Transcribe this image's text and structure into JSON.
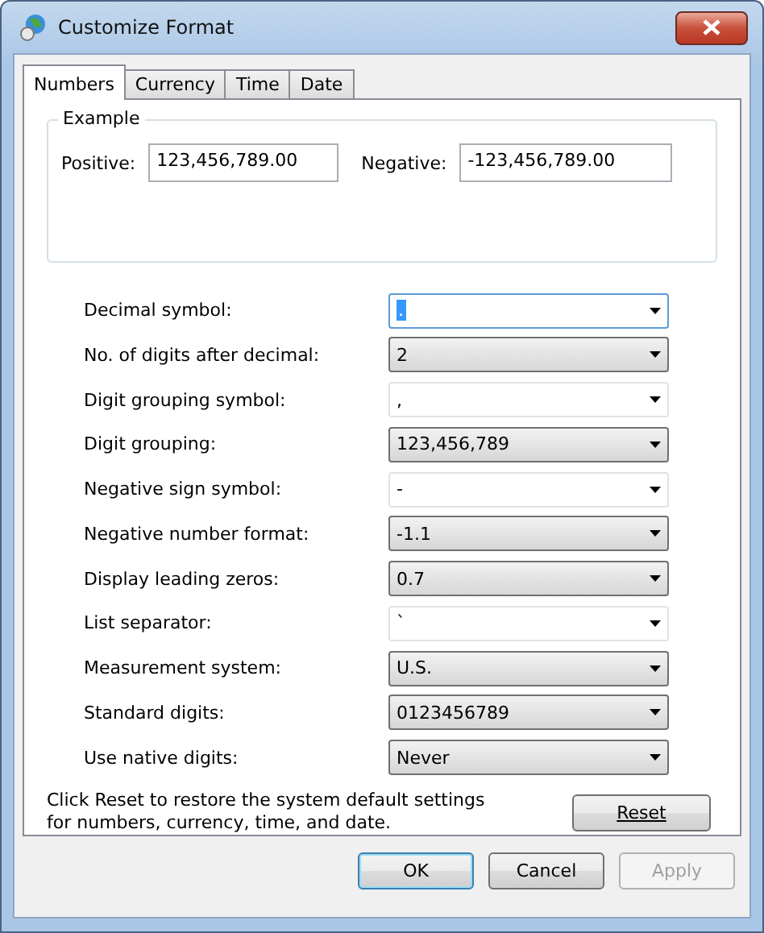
{
  "window": {
    "title": "Customize Format"
  },
  "tabs": [
    {
      "label": "Numbers",
      "selected": true
    },
    {
      "label": "Currency",
      "selected": false
    },
    {
      "label": "Time",
      "selected": false
    },
    {
      "label": "Date",
      "selected": false
    }
  ],
  "example": {
    "title": "Example",
    "positive_label": "Positive:",
    "positive": "123,456,789.00",
    "negative_label": "Negative:",
    "negative": "-123,456,789.00"
  },
  "settings": [
    {
      "label": "Decimal symbol:",
      "value": ".",
      "kind": "combo",
      "focused": true
    },
    {
      "label": "No. of digits after decimal:",
      "value": "2",
      "kind": "list",
      "focused": false
    },
    {
      "label": "Digit grouping symbol:",
      "value": ",",
      "kind": "combo",
      "focused": false
    },
    {
      "label": "Digit grouping:",
      "value": "123,456,789",
      "kind": "list",
      "focused": false
    },
    {
      "label": "Negative sign symbol:",
      "value": "-",
      "kind": "combo",
      "focused": false
    },
    {
      "label": "Negative number format:",
      "value": "-1.1",
      "kind": "list",
      "focused": false
    },
    {
      "label": "Display leading zeros:",
      "value": "0.7",
      "kind": "list",
      "focused": false
    },
    {
      "label": "List separator:",
      "value": "`",
      "kind": "combo",
      "focused": false
    },
    {
      "label": "Measurement system:",
      "value": "U.S.",
      "kind": "list",
      "focused": false
    },
    {
      "label": "Standard digits:",
      "value": "0123456789",
      "kind": "list",
      "focused": false
    },
    {
      "label": "Use native digits:",
      "value": "Never",
      "kind": "list",
      "focused": false
    }
  ],
  "reset": {
    "text": "Click Reset to restore the system default settings for numbers, currency, time, and date.",
    "button": "Reset"
  },
  "buttons": [
    {
      "label": "OK",
      "default": true,
      "disabled": false
    },
    {
      "label": "Cancel",
      "default": false,
      "disabled": false
    },
    {
      "label": "Apply",
      "default": false,
      "disabled": true
    }
  ]
}
